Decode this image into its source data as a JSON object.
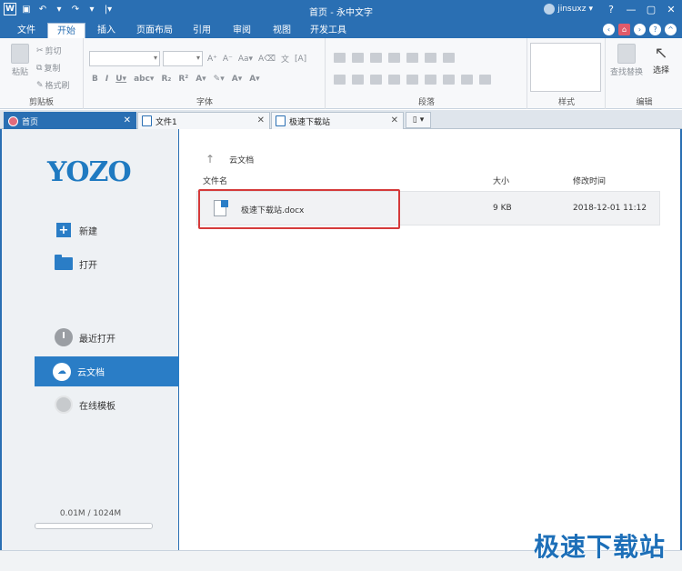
{
  "window": {
    "title": "首页 - 永中文字",
    "user": "jinsuxz"
  },
  "menu": {
    "tabs": [
      "文件",
      "开始",
      "插入",
      "页面布局",
      "引用",
      "审阅",
      "视图",
      "开发工具"
    ],
    "active": "开始"
  },
  "ribbon": {
    "clipboard": {
      "label": "剪贴板",
      "paste": "粘贴",
      "cut": "剪切",
      "copy": "复制",
      "format_painter": "格式刷"
    },
    "font": {
      "label": "字体"
    },
    "paragraph": {
      "label": "段落"
    },
    "style": {
      "label": "样式"
    },
    "edit": {
      "label": "编辑",
      "find_replace": "查找替换",
      "select": "选择"
    }
  },
  "doc_tabs": [
    {
      "label": "首页",
      "active": true
    },
    {
      "label": "文件1",
      "active": false
    },
    {
      "label": "极速下载站",
      "active": false
    }
  ],
  "sidebar": {
    "logo": "YOZO",
    "new": "新建",
    "open": "打开",
    "recent": "最近打开",
    "cloud": "云文档",
    "templates": "在线模板",
    "storage": "0.01M / 1024M",
    "storage_used_fraction": 1e-05
  },
  "content": {
    "breadcrumb": "云文档",
    "columns": {
      "name": "文件名",
      "size": "大小",
      "modified": "修改时间"
    },
    "files": [
      {
        "name": "极速下载站.docx",
        "size": "9 KB",
        "modified": "2018-12-01 11:12"
      }
    ]
  },
  "watermark": "极速下载站",
  "colors": {
    "accent": "#2a6fb3",
    "highlight": "#d53a3a"
  }
}
